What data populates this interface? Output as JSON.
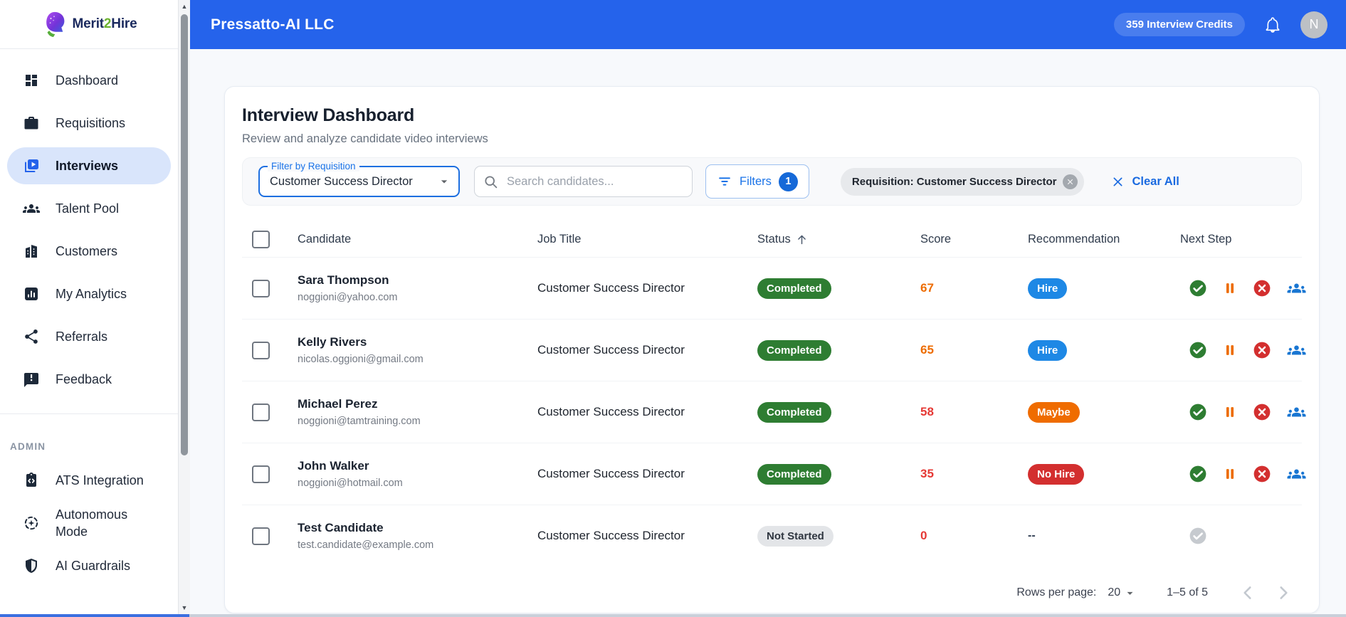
{
  "topbar": {
    "company": "Pressatto-AI LLC",
    "credits": "359 Interview Credits",
    "avatar_initial": "N"
  },
  "sidebar": {
    "logo": {
      "merit": "Merit",
      "two": "2",
      "hire": "Hire"
    },
    "items": [
      {
        "id": "dashboard",
        "label": "Dashboard",
        "icon": "i-dashboard",
        "active": false
      },
      {
        "id": "requisitions",
        "label": "Requisitions",
        "icon": "i-briefcase",
        "active": false
      },
      {
        "id": "interviews",
        "label": "Interviews",
        "icon": "i-interviews",
        "active": true
      },
      {
        "id": "talent-pool",
        "label": "Talent Pool",
        "icon": "i-groups",
        "active": false
      },
      {
        "id": "customers",
        "label": "Customers",
        "icon": "i-building",
        "active": false
      },
      {
        "id": "my-analytics",
        "label": "My Analytics",
        "icon": "i-analytics",
        "active": false
      },
      {
        "id": "referrals",
        "label": "Referrals",
        "icon": "i-share",
        "active": false
      },
      {
        "id": "feedback",
        "label": "Feedback",
        "icon": "i-feedback",
        "active": false
      }
    ],
    "admin_label": "ADMIN",
    "admin_items": [
      {
        "id": "ats-integration",
        "label": "ATS Integration",
        "icon": "i-ats",
        "active": false
      },
      {
        "id": "autonomous-mode",
        "label": "Autonomous Mode",
        "icon": "i-auto",
        "active": false
      },
      {
        "id": "ai-guardrails",
        "label": "AI Guardrails",
        "icon": "i-shield",
        "active": false
      }
    ]
  },
  "main": {
    "title": "Interview Dashboard",
    "subtitle": "Review and analyze candidate video interviews",
    "filters": {
      "requisition_label": "Filter by Requisition",
      "requisition_value": "Customer Success Director",
      "search_placeholder": "Search candidates...",
      "filters_button": "Filters",
      "filters_count": "1",
      "active_chip": "Requisition: Customer Success Director",
      "clear_all": "Clear All"
    },
    "table": {
      "columns": [
        "Candidate",
        "Job Title",
        "Status",
        "Score",
        "Recommendation",
        "Next Step"
      ],
      "sorted_column": "Status",
      "sort_direction": "asc",
      "next_step_icons": [
        "check-circle-icon",
        "pause-icon",
        "cancel-icon",
        "groups-icon"
      ],
      "rows": [
        {
          "name": "Sara Thompson",
          "email": "noggioni@yahoo.com",
          "job": "Customer Success Director",
          "status": "Completed",
          "status_type": "completed",
          "score": "67",
          "score_level": "mid",
          "recommendation": "Hire",
          "rec_type": "hire",
          "actions": "active"
        },
        {
          "name": "Kelly Rivers",
          "email": "nicolas.oggioni@gmail.com",
          "job": "Customer Success Director",
          "status": "Completed",
          "status_type": "completed",
          "score": "65",
          "score_level": "mid",
          "recommendation": "Hire",
          "rec_type": "hire",
          "actions": "active"
        },
        {
          "name": "Michael Perez",
          "email": "noggioni@tamtraining.com",
          "job": "Customer Success Director",
          "status": "Completed",
          "status_type": "completed",
          "score": "58",
          "score_level": "low",
          "recommendation": "Maybe",
          "rec_type": "maybe",
          "actions": "active"
        },
        {
          "name": "John Walker",
          "email": "noggioni@hotmail.com",
          "job": "Customer Success Director",
          "status": "Completed",
          "status_type": "completed",
          "score": "35",
          "score_level": "low",
          "recommendation": "No Hire",
          "rec_type": "no_hire",
          "actions": "active"
        },
        {
          "name": "Test Candidate",
          "email": "test.candidate@example.com",
          "job": "Customer Success Director",
          "status": "Not Started",
          "status_type": "not_started",
          "score": "0",
          "score_level": "low",
          "recommendation": "--",
          "rec_type": "none",
          "actions": "none"
        }
      ]
    },
    "pagination": {
      "rows_per_page_label": "Rows per page:",
      "rows_per_page": "20",
      "range": "1–5 of 5"
    }
  },
  "colors": {
    "topbar_blue": "#2563eb",
    "active_item_bg": "#d9e5fb",
    "completed_green": "#2e7d32",
    "hire_blue": "#1e88e5",
    "maybe_orange": "#ef6c00",
    "no_hire_red": "#d32f2f",
    "score_mid_orange": "#ed6c02",
    "score_low_red": "#e53935",
    "logo_green": "#6db32f",
    "logo_navy": "#1b2a5e"
  }
}
